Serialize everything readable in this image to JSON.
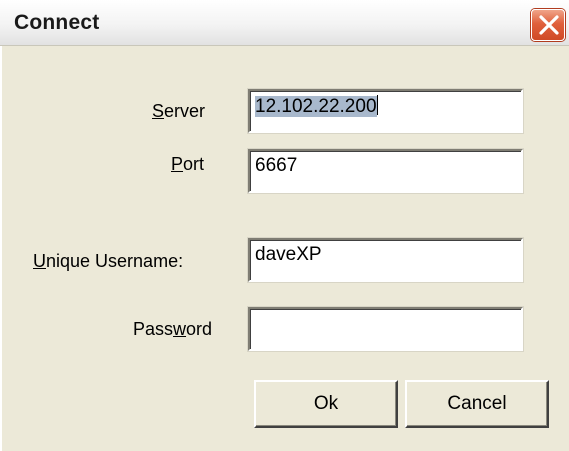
{
  "window": {
    "title": "Connect"
  },
  "form": {
    "server": {
      "label_mnemonic": "S",
      "label_rest": "erver",
      "value": "12.102.22.200"
    },
    "port": {
      "label_mnemonic": "P",
      "label_rest": "ort",
      "value": "6667"
    },
    "username": {
      "label_mnemonic": "U",
      "label_rest": "nique Username:",
      "value": "daveXP"
    },
    "password": {
      "label_pre": "Pass",
      "label_mnemonic": "w",
      "label_rest": "ord",
      "value": ""
    }
  },
  "buttons": {
    "ok_label": "Ok",
    "cancel_label": "Cancel"
  },
  "icons": {
    "close": "close-icon"
  },
  "colors": {
    "close_button": "#e0603c",
    "selection": "#a8b8cc",
    "dialog_bg": "#ece9d8"
  }
}
